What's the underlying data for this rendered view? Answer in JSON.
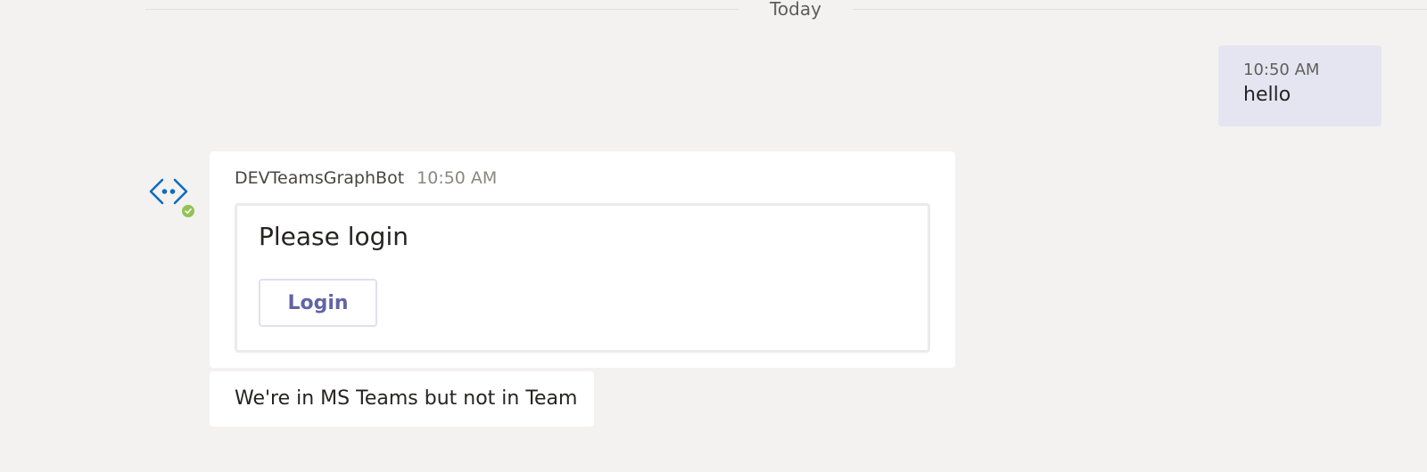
{
  "divider": {
    "label": "Today"
  },
  "sent_message": {
    "time": "10:50 AM",
    "text": "hello"
  },
  "bot": {
    "avatar_icon": "bot-code-icon",
    "status": "available",
    "status_color": "#92c353",
    "accent_color": "#0f6cbd"
  },
  "bot_message": {
    "sender": "DEVTeamsGraphBot",
    "time": "10:50 AM",
    "card": {
      "title": "Please login",
      "button_label": "Login"
    }
  },
  "bot_followup": {
    "text": "We're in MS Teams but not in Team"
  }
}
